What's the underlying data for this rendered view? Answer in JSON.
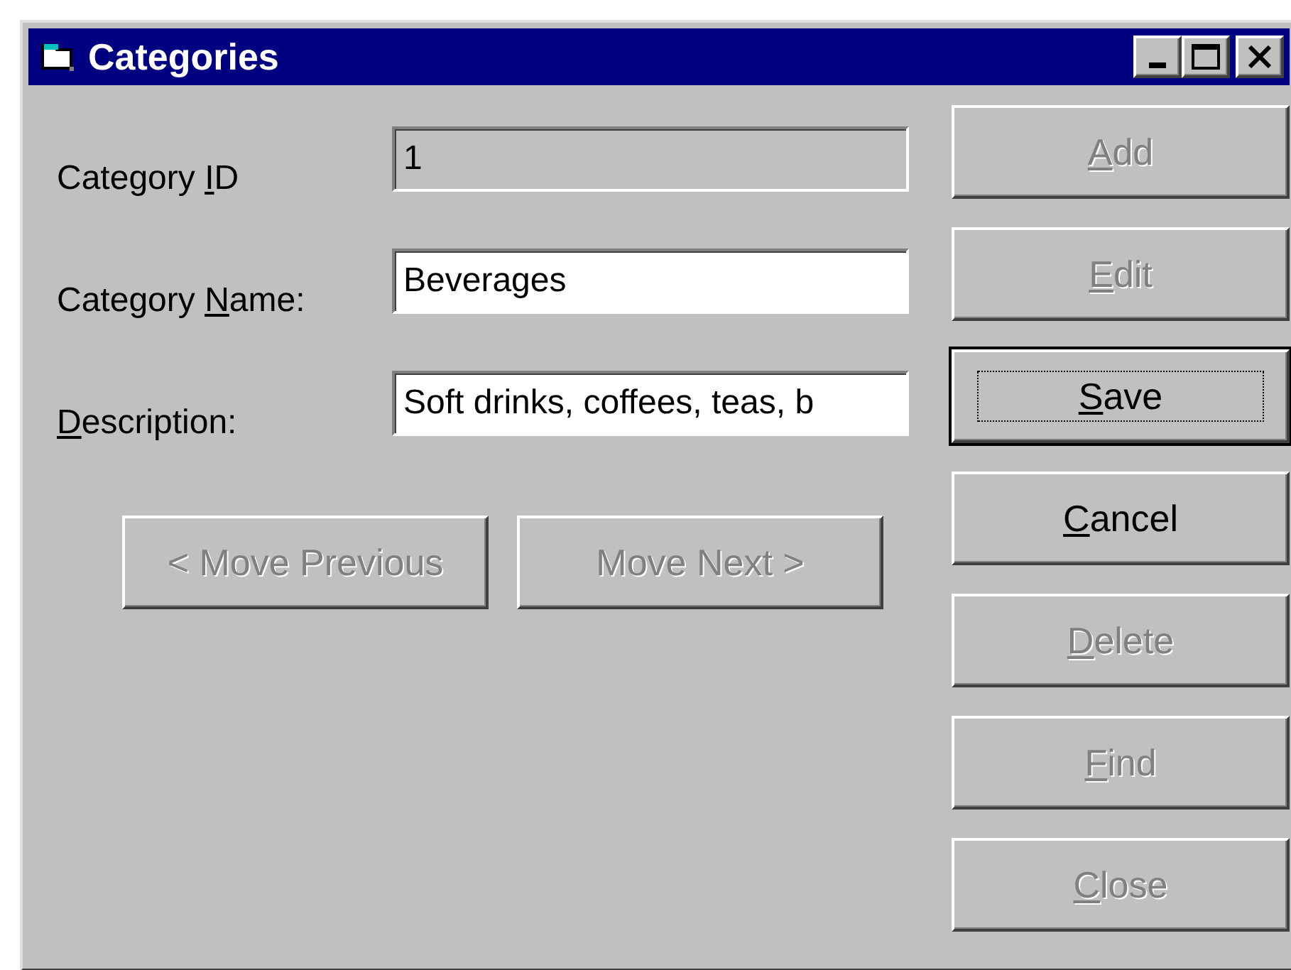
{
  "window": {
    "title": "Categories"
  },
  "fields": [
    {
      "label": [
        {
          "text": "Category ",
          "underlined": false
        },
        {
          "text": "I",
          "underlined": true
        },
        {
          "text": "D",
          "underlined": false
        }
      ],
      "value": "1",
      "disabled": true
    },
    {
      "label": [
        {
          "text": "Category ",
          "underlined": false
        },
        {
          "text": "N",
          "underlined": true
        },
        {
          "text": "ame:",
          "underlined": false
        }
      ],
      "value": "Beverages",
      "disabled": false
    },
    {
      "label": [
        {
          "text": "D",
          "underlined": true
        },
        {
          "text": "escription:",
          "underlined": false
        }
      ],
      "value": "Soft drinks, coffees, teas, b",
      "disabled": false
    }
  ],
  "navigation_buttons": [
    {
      "label": [
        {
          "text": "< Move Previous",
          "underlined": false
        }
      ],
      "disabled": true
    },
    {
      "label": [
        {
          "text": "Move Next >",
          "underlined": false
        }
      ],
      "disabled": true
    }
  ],
  "action_buttons": [
    {
      "label": [
        {
          "text": "A",
          "underlined": true
        },
        {
          "text": "dd",
          "underlined": false
        }
      ],
      "disabled": true,
      "focused": false
    },
    {
      "label": [
        {
          "text": "E",
          "underlined": true
        },
        {
          "text": "dit",
          "underlined": false
        }
      ],
      "disabled": true,
      "focused": false
    },
    {
      "label": [
        {
          "text": "S",
          "underlined": true
        },
        {
          "text": "ave",
          "underlined": false
        }
      ],
      "disabled": false,
      "focused": true
    },
    {
      "label": [
        {
          "text": "C",
          "underlined": true
        },
        {
          "text": "ancel",
          "underlined": false
        }
      ],
      "disabled": false,
      "focused": false
    },
    {
      "label": [
        {
          "text": "D",
          "underlined": true
        },
        {
          "text": "elete",
          "underlined": false
        }
      ],
      "disabled": true,
      "focused": false
    },
    {
      "label": [
        {
          "text": "F",
          "underlined": true
        },
        {
          "text": "ind",
          "underlined": false
        }
      ],
      "disabled": true,
      "focused": false
    },
    {
      "label": [
        {
          "text": "C",
          "underlined": true
        },
        {
          "text": "lose",
          "underlined": false
        }
      ],
      "disabled": true,
      "focused": false
    }
  ]
}
